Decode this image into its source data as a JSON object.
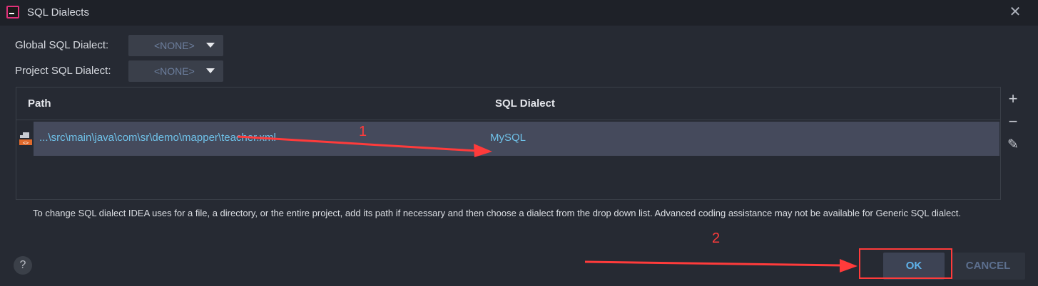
{
  "window": {
    "title": "SQL Dialects",
    "close_glyph": "✕"
  },
  "global_dialect": {
    "label": "Global SQL Dialect:",
    "value": "<NONE>"
  },
  "project_dialect": {
    "label": "Project SQL Dialect:",
    "value": "<NONE>"
  },
  "table": {
    "columns": [
      "Path",
      "SQL Dialect"
    ],
    "rows": [
      {
        "path": "...\\src\\main\\java\\com\\sr\\demo\\mapper\\teacher.xml",
        "dialect": "MySQL",
        "icon": "xml-file-icon"
      }
    ]
  },
  "side_toolbar": {
    "add": "+",
    "remove": "−",
    "edit": "✎"
  },
  "hint": "To change SQL dialect IDEA uses for a file, a directory, or the entire project, add its path if necessary and then choose a dialect from the drop down list. Advanced coding assistance may not be available for Generic SQL dialect.",
  "help": "?",
  "buttons": {
    "ok": "OK",
    "cancel": "CANCEL"
  },
  "annotations": {
    "n1": "1",
    "n2": "2",
    "color": "#ff3b3b"
  }
}
